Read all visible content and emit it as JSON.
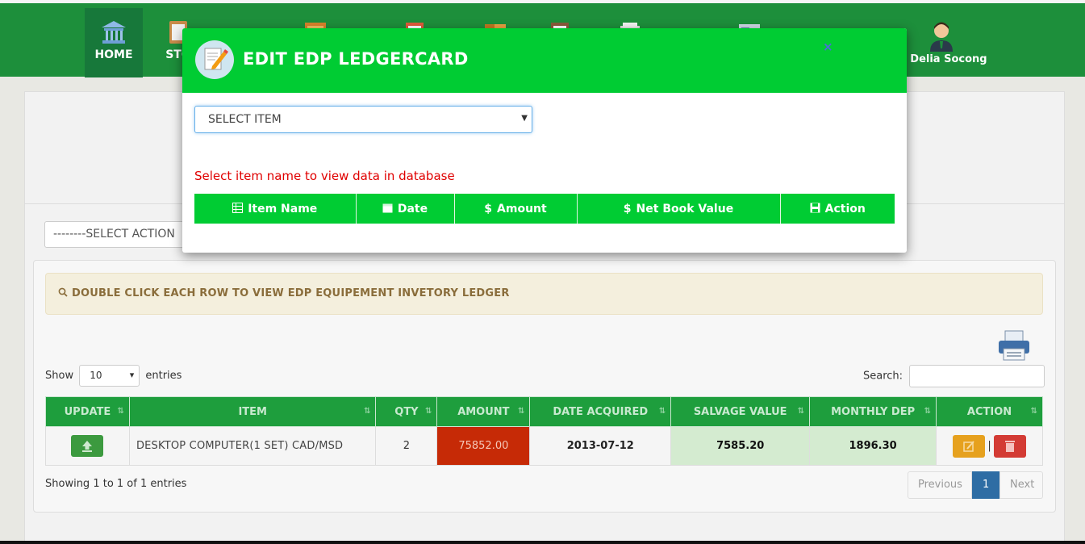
{
  "nav": {
    "items": [
      {
        "label": "HOME",
        "icon": "bank-icon"
      },
      {
        "label": "STO",
        "icon": "clipboard-icon"
      },
      {
        "label": "",
        "icon": "cabinet-icon"
      },
      {
        "label": "",
        "icon": "checklist-icon"
      },
      {
        "label": "",
        "icon": "folders-icon"
      },
      {
        "label": "",
        "icon": "report-icon"
      },
      {
        "label": "",
        "icon": "stack-icon"
      },
      {
        "label": "",
        "icon": "card-icon"
      }
    ],
    "user_name": "e, Delia Socong"
  },
  "page": {
    "action_select": "--------SELECT ACTION",
    "notice": "DOUBLE CLICK EACH ROW TO VIEW EDP EQUIPEMENT INVETORY LEDGER",
    "show_label": "Show",
    "entries_label": "entries",
    "entries_value": "10",
    "search_label": "Search:",
    "table": {
      "columns": [
        "UPDATE",
        "ITEM",
        "QTY",
        "AMOUNT",
        "DATE ACQUIRED",
        "SALVAGE VALUE",
        "MONTHLY DEP",
        "ACTION"
      ],
      "rows": [
        {
          "item": "DESKTOP COMPUTER(1 SET) CAD/MSD",
          "qty": "2",
          "amount": "75852.00",
          "date_acquired": "2013-07-12",
          "salvage_value": "7585.20",
          "monthly_dep": "1896.30"
        }
      ]
    },
    "showing": "Showing 1 to 1 of 1 entries",
    "pager": {
      "previous": "Previous",
      "current": "1",
      "next": "Next"
    }
  },
  "modal": {
    "title": "EDIT EDP LEDGERCARD",
    "close": "×",
    "select_placeholder": "SELECT ITEM",
    "hint": "Select item name to view data in database",
    "columns": [
      "Item Name",
      "Date",
      "Amount",
      "Net Book Value",
      "Action"
    ]
  },
  "colors": {
    "nav_green": "#1d8f3b",
    "modal_green": "#00cc33",
    "amount_red": "#c62a06",
    "hint_red": "#e00000"
  }
}
